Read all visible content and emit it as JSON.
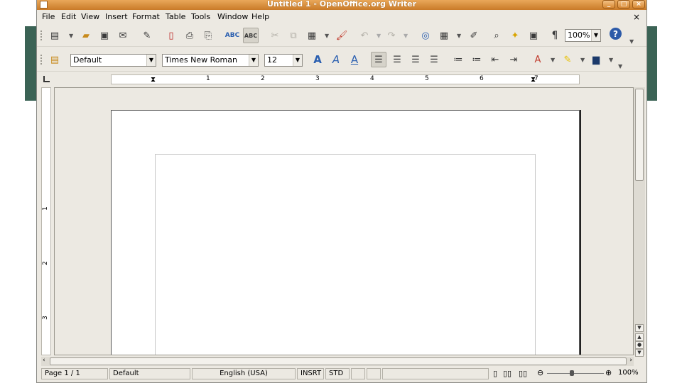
{
  "window": {
    "title": "Untitled 1 - OpenOffice.org Writer"
  },
  "menu": [
    "File",
    "Edit",
    "View",
    "Insert",
    "Format",
    "Table",
    "Tools",
    "Window",
    "Help"
  ],
  "toolbar": {
    "zoom_value": "100%",
    "pilcrow": "¶"
  },
  "format_toolbar": {
    "style": "Default",
    "font": "Times New Roman",
    "size": "12"
  },
  "ruler": {
    "h_numbers": [
      "1",
      "2",
      "3",
      "4",
      "5",
      "6",
      "7"
    ],
    "v_numbers": [
      "1",
      "2",
      "3"
    ]
  },
  "status": {
    "page": "Page 1 / 1",
    "style": "Default",
    "language": "English (USA)",
    "insert_mode": "INSRT",
    "selection_mode": "STD",
    "zoom": "100%",
    "zoom_level": 1.0
  },
  "colors": {
    "titlebar": "#d98d3c",
    "chrome": "#ece9e2",
    "accent_band": "#3b6355"
  }
}
